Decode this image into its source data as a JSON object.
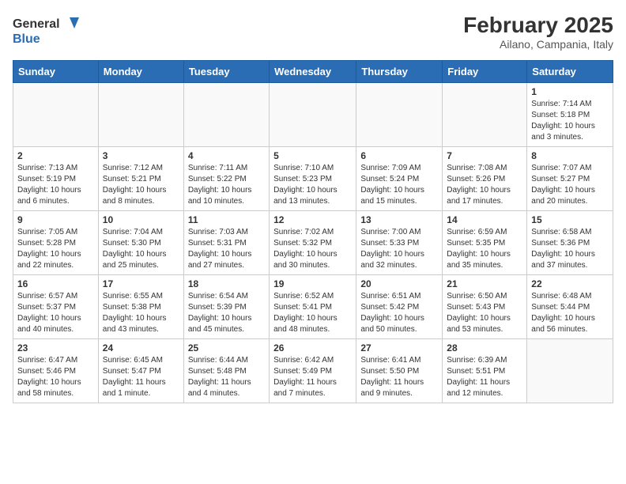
{
  "header": {
    "logo_general": "General",
    "logo_blue": "Blue",
    "title": "February 2025",
    "subtitle": "Ailano, Campania, Italy"
  },
  "days_of_week": [
    "Sunday",
    "Monday",
    "Tuesday",
    "Wednesday",
    "Thursday",
    "Friday",
    "Saturday"
  ],
  "weeks": [
    [
      {
        "day": "",
        "info": ""
      },
      {
        "day": "",
        "info": ""
      },
      {
        "day": "",
        "info": ""
      },
      {
        "day": "",
        "info": ""
      },
      {
        "day": "",
        "info": ""
      },
      {
        "day": "",
        "info": ""
      },
      {
        "day": "1",
        "info": "Sunrise: 7:14 AM\nSunset: 5:18 PM\nDaylight: 10 hours and 3 minutes."
      }
    ],
    [
      {
        "day": "2",
        "info": "Sunrise: 7:13 AM\nSunset: 5:19 PM\nDaylight: 10 hours and 6 minutes."
      },
      {
        "day": "3",
        "info": "Sunrise: 7:12 AM\nSunset: 5:21 PM\nDaylight: 10 hours and 8 minutes."
      },
      {
        "day": "4",
        "info": "Sunrise: 7:11 AM\nSunset: 5:22 PM\nDaylight: 10 hours and 10 minutes."
      },
      {
        "day": "5",
        "info": "Sunrise: 7:10 AM\nSunset: 5:23 PM\nDaylight: 10 hours and 13 minutes."
      },
      {
        "day": "6",
        "info": "Sunrise: 7:09 AM\nSunset: 5:24 PM\nDaylight: 10 hours and 15 minutes."
      },
      {
        "day": "7",
        "info": "Sunrise: 7:08 AM\nSunset: 5:26 PM\nDaylight: 10 hours and 17 minutes."
      },
      {
        "day": "8",
        "info": "Sunrise: 7:07 AM\nSunset: 5:27 PM\nDaylight: 10 hours and 20 minutes."
      }
    ],
    [
      {
        "day": "9",
        "info": "Sunrise: 7:05 AM\nSunset: 5:28 PM\nDaylight: 10 hours and 22 minutes."
      },
      {
        "day": "10",
        "info": "Sunrise: 7:04 AM\nSunset: 5:30 PM\nDaylight: 10 hours and 25 minutes."
      },
      {
        "day": "11",
        "info": "Sunrise: 7:03 AM\nSunset: 5:31 PM\nDaylight: 10 hours and 27 minutes."
      },
      {
        "day": "12",
        "info": "Sunrise: 7:02 AM\nSunset: 5:32 PM\nDaylight: 10 hours and 30 minutes."
      },
      {
        "day": "13",
        "info": "Sunrise: 7:00 AM\nSunset: 5:33 PM\nDaylight: 10 hours and 32 minutes."
      },
      {
        "day": "14",
        "info": "Sunrise: 6:59 AM\nSunset: 5:35 PM\nDaylight: 10 hours and 35 minutes."
      },
      {
        "day": "15",
        "info": "Sunrise: 6:58 AM\nSunset: 5:36 PM\nDaylight: 10 hours and 37 minutes."
      }
    ],
    [
      {
        "day": "16",
        "info": "Sunrise: 6:57 AM\nSunset: 5:37 PM\nDaylight: 10 hours and 40 minutes."
      },
      {
        "day": "17",
        "info": "Sunrise: 6:55 AM\nSunset: 5:38 PM\nDaylight: 10 hours and 43 minutes."
      },
      {
        "day": "18",
        "info": "Sunrise: 6:54 AM\nSunset: 5:39 PM\nDaylight: 10 hours and 45 minutes."
      },
      {
        "day": "19",
        "info": "Sunrise: 6:52 AM\nSunset: 5:41 PM\nDaylight: 10 hours and 48 minutes."
      },
      {
        "day": "20",
        "info": "Sunrise: 6:51 AM\nSunset: 5:42 PM\nDaylight: 10 hours and 50 minutes."
      },
      {
        "day": "21",
        "info": "Sunrise: 6:50 AM\nSunset: 5:43 PM\nDaylight: 10 hours and 53 minutes."
      },
      {
        "day": "22",
        "info": "Sunrise: 6:48 AM\nSunset: 5:44 PM\nDaylight: 10 hours and 56 minutes."
      }
    ],
    [
      {
        "day": "23",
        "info": "Sunrise: 6:47 AM\nSunset: 5:46 PM\nDaylight: 10 hours and 58 minutes."
      },
      {
        "day": "24",
        "info": "Sunrise: 6:45 AM\nSunset: 5:47 PM\nDaylight: 11 hours and 1 minute."
      },
      {
        "day": "25",
        "info": "Sunrise: 6:44 AM\nSunset: 5:48 PM\nDaylight: 11 hours and 4 minutes."
      },
      {
        "day": "26",
        "info": "Sunrise: 6:42 AM\nSunset: 5:49 PM\nDaylight: 11 hours and 7 minutes."
      },
      {
        "day": "27",
        "info": "Sunrise: 6:41 AM\nSunset: 5:50 PM\nDaylight: 11 hours and 9 minutes."
      },
      {
        "day": "28",
        "info": "Sunrise: 6:39 AM\nSunset: 5:51 PM\nDaylight: 11 hours and 12 minutes."
      },
      {
        "day": "",
        "info": ""
      }
    ]
  ]
}
